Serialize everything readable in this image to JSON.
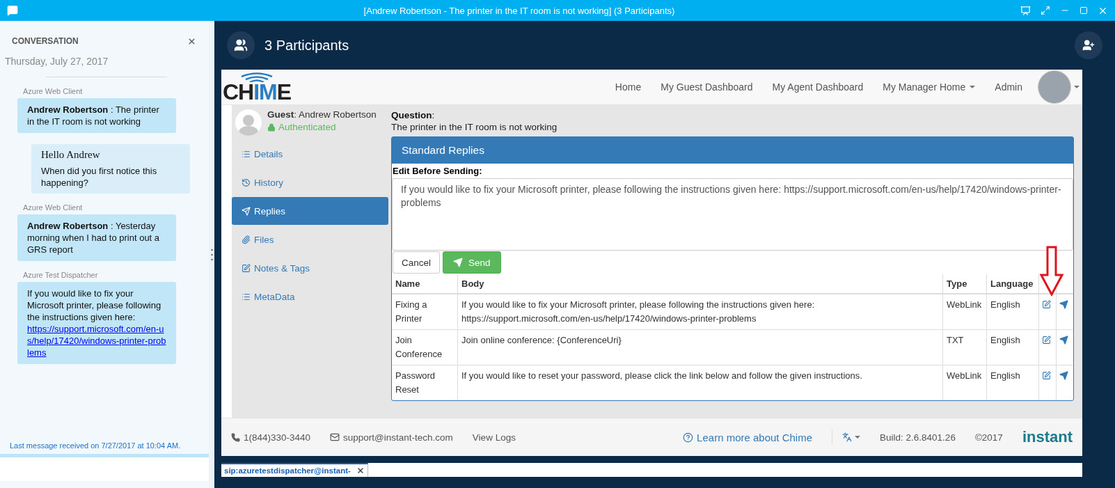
{
  "window": {
    "title": "[Andrew Robertson - The printer in the IT room is not working] (3 Participants)"
  },
  "conversation": {
    "heading": "CONVERSATION",
    "date": "Thursday, July 27, 2017",
    "messages": [
      {
        "kind": "incoming",
        "sender": "Azure Web Client",
        "author": "Andrew Robertson",
        "text": ": The printer in the IT room is not working"
      },
      {
        "kind": "outgoing",
        "title": "Hello Andrew",
        "text": "When did you first notice this happening?"
      },
      {
        "kind": "incoming",
        "sender": "Azure Web Client",
        "author": "Andrew Robertson",
        "text": ": Yesterday morning when I had to print out a GRS report"
      },
      {
        "kind": "incoming",
        "sender": "Azure Test Dispatcher",
        "text": "If you would like to fix your Microsoft printer, please following the instructions given here:",
        "link": "https://support.microsoft.com/en-us/help/17420/windows-printer-problems"
      }
    ],
    "status": "Last message received on 7/27/2017 at 10:04 AM."
  },
  "call": {
    "title": "3 Participants"
  },
  "app": {
    "logo": [
      {
        "text": "CH",
        "color": "#222222"
      },
      {
        "text": "IM",
        "color": "#2a7fc4"
      },
      {
        "text": "E",
        "color": "#222222"
      }
    ],
    "nav": [
      {
        "label": "Home",
        "dropdown": false
      },
      {
        "label": "My Guest Dashboard",
        "dropdown": false
      },
      {
        "label": "My Agent Dashboard",
        "dropdown": false
      },
      {
        "label": "My Manager Home",
        "dropdown": true
      },
      {
        "label": "Admin",
        "dropdown": false
      }
    ],
    "guest": {
      "label": "**Guest**: Andrew Robertson",
      "status": "Authenticated",
      "authenticated": true
    },
    "question": {
      "label": "**Question**:",
      "text": "The printer in the IT room is not working"
    },
    "menu": [
      {
        "label": "Details",
        "kind": "list",
        "selected": false
      },
      {
        "label": "History",
        "kind": "history",
        "selected": false
      },
      {
        "label": "Replies",
        "kind": "send",
        "selected": true
      },
      {
        "label": "Files",
        "kind": "clip",
        "selected": false
      },
      {
        "label": "Notes & Tags",
        "kind": "edit",
        "selected": false
      },
      {
        "label": "MetaData",
        "kind": "list",
        "selected": false
      }
    ],
    "replies": {
      "title": "Standard Replies",
      "edit_label": "Edit Before Sending:",
      "draft": "If you would like to fix your Microsoft printer, please following the instructions given here: https://support.microsoft.com/en-us/help/17420/windows-printer-problems",
      "cancel": "Cancel",
      "send": "Send",
      "columns": [
        "Name",
        "Body",
        "Type",
        "Language"
      ],
      "rows": [
        {
          "name": "Fixing a Printer",
          "body": "If you would like to fix your Microsoft printer, please following the instructions given here: https://support.microsoft.com/en-us/help/17420/windows-printer-problems",
          "type": "WebLink",
          "language": "English"
        },
        {
          "name": "Join Conference",
          "body": "Join online conference: {ConferenceUri}",
          "type": "TXT",
          "language": "English"
        },
        {
          "name": "Password Reset",
          "body": "If you would like to reset your password, please click the link below and follow the given instructions.",
          "type": "WebLink",
          "language": "English"
        }
      ]
    },
    "footer": {
      "phone": "1(844)330-3440",
      "email": "support@instant-tech.com",
      "logs": "View Logs",
      "learn": "Learn more about Chime",
      "build": "Build: 2.6.8401.26",
      "copyright": "©2017",
      "brand": "instant"
    }
  },
  "tabs": [
    {
      "label": "sip:azuretestdispatcher@instant-",
      "selected": true
    }
  ]
}
